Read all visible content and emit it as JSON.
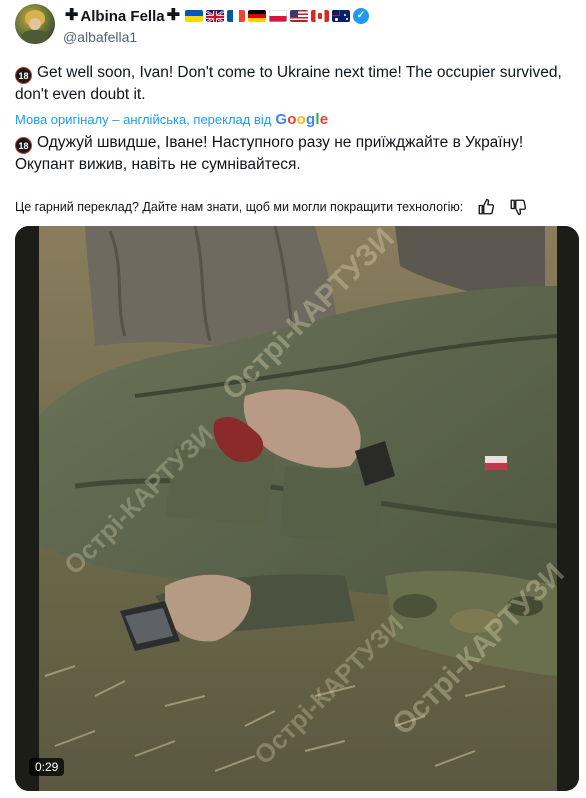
{
  "author": {
    "display_name": "Albina Fella",
    "handle": "@albafella1",
    "verified": true,
    "avatar_icon": "profile-photo",
    "name_decorations": [
      "cross",
      "ukraine-flag",
      "uk-flag",
      "france-flag",
      "germany-flag",
      "poland-flag",
      "usa-flag",
      "canada-flag",
      "australia-flag",
      "cross"
    ]
  },
  "tweet": {
    "age_badge": "18",
    "text": "Get well soon, Ivan! Don't come to Ukraine next time! The occupier survived, don't even doubt it."
  },
  "translation": {
    "label": "Мова оригіналу – англійська, переклад від",
    "provider": "Google",
    "age_badge": "18",
    "text": "Одужуй швидше, Іване! Наступного разу не приїжджайте в Україну! Окупант вижив, навіть не сумнівайтеся.",
    "feedback_prompt": "Це гарний переклад? Дайте нам знати, щоб ми могли покращити технологію:"
  },
  "media": {
    "type": "video",
    "duration": "0:29",
    "watermark": "Острі-КАРТУЗИ"
  },
  "colors": {
    "accent": "#1d9bf0",
    "text": "#0f1419",
    "secondary": "#536471"
  }
}
